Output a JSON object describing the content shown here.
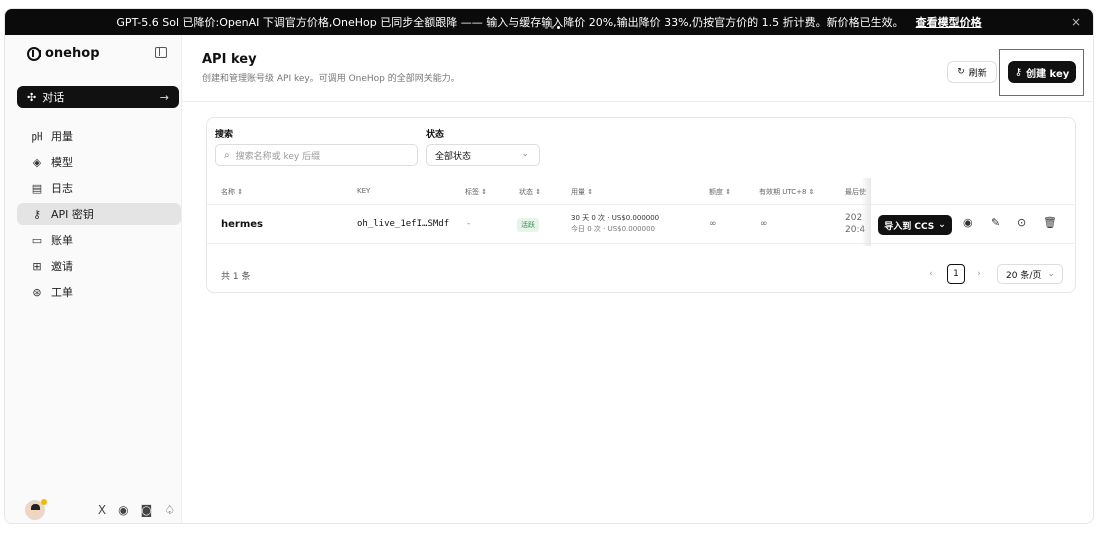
{
  "banner": {
    "text": "GPT-5.6 Sol 已降价:OpenAI 下调官方价格,OneHop 已同步全额跟降 —— 输入与缓存输入降价 20%,输出降价 33%,仍按官方价的 1.5 折计费。新价格已生效。",
    "link": "查看模型价格",
    "close_icon": "×"
  },
  "sidebar": {
    "logo_text": "onehop",
    "chat_button": {
      "label": "对话",
      "icon": "✣",
      "arrow": "→"
    },
    "items": [
      {
        "label": "用量",
        "icon": "㏗"
      },
      {
        "label": "模型",
        "icon": "◈"
      },
      {
        "label": "日志",
        "icon": "▤"
      },
      {
        "label": "API 密钥",
        "icon": "⚷"
      },
      {
        "label": "账单",
        "icon": "▭"
      },
      {
        "label": "邀请",
        "icon": "⊞"
      },
      {
        "label": "工单",
        "icon": "⊛"
      }
    ],
    "bottom_icons": {
      "x": "X",
      "telegram": "◉",
      "discord": "◙",
      "bell": "♤"
    }
  },
  "header": {
    "title": "API key",
    "subtitle": "创建和管理账号级 API key。可调用 OneHop 的全部网关能力。",
    "refresh_label": "刷新",
    "create_label": "创建 key",
    "refresh_icon": "↻",
    "create_icon": "⚷"
  },
  "filters": {
    "search_label": "搜索",
    "search_placeholder": "搜索名称或 key 后缀",
    "status_label": "状态",
    "status_value": "全部状态"
  },
  "table": {
    "columns": [
      "名称 ⇕",
      "KEY",
      "标签 ⇕",
      "状态 ⇕",
      "用量 ⇕",
      "额度 ⇕",
      "有效期 UTC+8 ⇕",
      "最后使"
    ],
    "rows": [
      {
        "name": "hermes",
        "key": "oh_live_1efI…SMdf",
        "tags": "-",
        "status": "活跃",
        "usage_30d": "30 天 0 次 · US$0.000000",
        "usage_today": "今日 0 次 · US$0.000000",
        "quota": "∞",
        "expiry": "∞",
        "last_used_1": "202",
        "last_used_2": "20:4",
        "import_label": "导入到 CCS",
        "import_chevron": "⌄"
      }
    ]
  },
  "pagination": {
    "total": "共 1 条",
    "prev": "‹",
    "current": "1",
    "next": "›",
    "page_size": "20 条/页"
  }
}
